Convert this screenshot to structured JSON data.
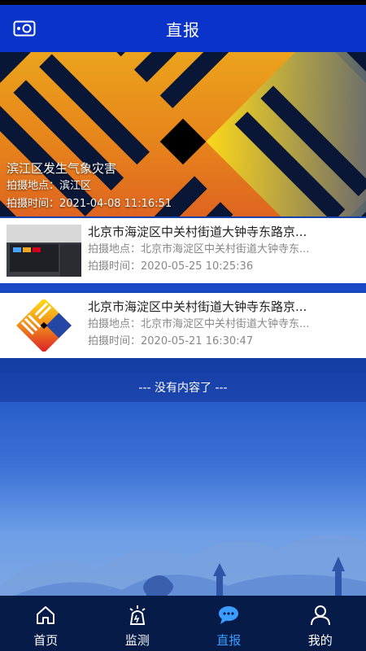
{
  "header": {
    "title": "直报",
    "camera_icon": "camera-icon"
  },
  "hero": {
    "title": "滨江区发生气象灾害",
    "location_label": "拍摄地点：",
    "location": "滨江区",
    "time_label": "拍摄时间：",
    "time": "2021-04-08 11:16:51"
  },
  "reports": [
    {
      "title": "北京市海淀区中关村街道大钟寺东路京...",
      "location_label": "拍摄地点：",
      "location": "北京市海淀区中关村街道大钟寺东...",
      "time_label": "拍摄时间：",
      "time": "2020-05-25 10:25:36"
    },
    {
      "title": "北京市海淀区中关村街道大钟寺东路京...",
      "location_label": "拍摄地点：",
      "location": "北京市海淀区中关村街道大钟寺东...",
      "time_label": "拍摄时间：",
      "time": "2020-05-21 16:30:47"
    }
  ],
  "list_end": "--- 没有内容了 ---",
  "tabbar": {
    "items": [
      {
        "label": "首页",
        "icon": "home-icon"
      },
      {
        "label": "监测",
        "icon": "monitor-icon"
      },
      {
        "label": "直报",
        "icon": "chat-icon",
        "active": true
      },
      {
        "label": "我的",
        "icon": "user-icon"
      }
    ]
  },
  "colors": {
    "header": "#0a34c9",
    "tabbar": "#061b48",
    "active_tab": "#3b9dff"
  }
}
